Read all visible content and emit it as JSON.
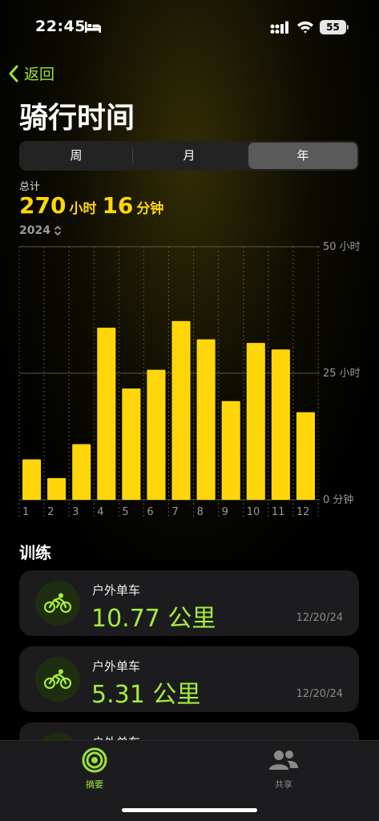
{
  "status": {
    "time": "22:45",
    "battery": "55"
  },
  "nav": {
    "back_label": "返回"
  },
  "title": "骑行时间",
  "segments": [
    {
      "label": "周",
      "active": false
    },
    {
      "label": "月",
      "active": false
    },
    {
      "label": "年",
      "active": true
    }
  ],
  "summary": {
    "total_label": "总计",
    "hours": "270",
    "hours_unit": "小时",
    "minutes": "16",
    "minutes_unit": "分钟",
    "year": "2024"
  },
  "chart_data": {
    "type": "bar",
    "categories": [
      "1",
      "2",
      "3",
      "4",
      "5",
      "6",
      "7",
      "8",
      "9",
      "10",
      "11",
      "12"
    ],
    "values": [
      8,
      4.3,
      11,
      34,
      22,
      25.7,
      35.3,
      31.7,
      19.5,
      31,
      29.7,
      17.3
    ],
    "y_unit": "hours",
    "ylim": [
      0,
      50
    ],
    "y_tick_labels": [
      "50 小时",
      "25 小时",
      "0 分钟"
    ],
    "bar_color": "#ffd60a",
    "grid": true
  },
  "workouts_section": {
    "title": "训练"
  },
  "workouts": [
    {
      "title": "户外单车",
      "value": "10.77 公里",
      "date": "12/20/24"
    },
    {
      "title": "户外单车",
      "value": "5.31 公里",
      "date": "12/20/24"
    },
    {
      "title": "户外单车",
      "value": "",
      "date": ""
    }
  ],
  "tabbar": {
    "tabs": [
      {
        "label": "摘要",
        "icon": "activity-rings-icon",
        "active": true
      },
      {
        "label": "共享",
        "icon": "people-icon",
        "active": false
      }
    ]
  },
  "colors": {
    "accent_green": "#9de33a",
    "value_green": "#a4ed3c",
    "yellow": "#ffd60a",
    "card_bg": "#1c1c1e"
  }
}
